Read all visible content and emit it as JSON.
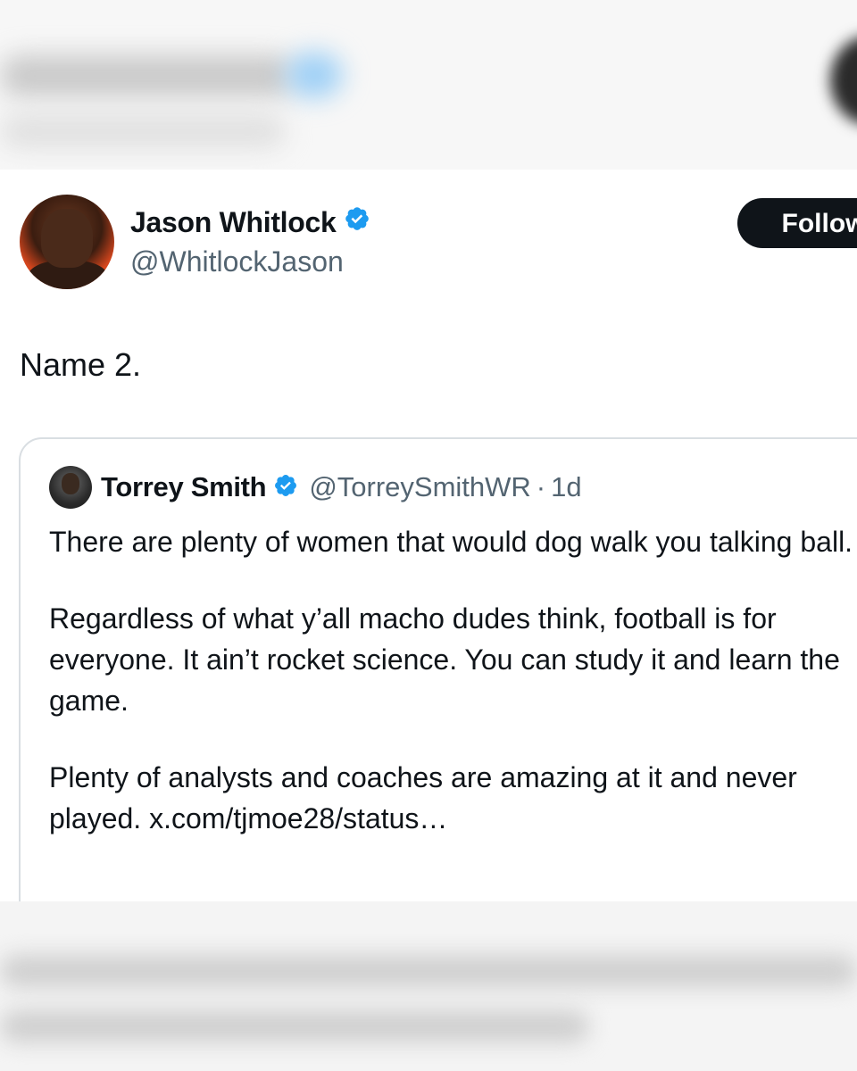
{
  "tweet": {
    "author_name": "Jason Whitlock",
    "author_handle": "@WhitlockJason",
    "follow_label": "Follow",
    "text": "Name 2."
  },
  "quoted": {
    "author_name": "Torrey Smith",
    "author_handle": "@TorreySmithWR",
    "separator": "·",
    "age": "1d",
    "paragraphs": [
      "There are plenty of women that would dog walk you talking ball.",
      "Regardless of what y’all macho dudes think, football is for everyone. It ain’t rocket science. You can study it and learn the game.",
      "Plenty of analysts and coaches are amazing at it and never played. x.com/tjmoe28/status…"
    ]
  },
  "colors": {
    "verified_badge": "#1d9bf0",
    "text_primary": "#0f1419",
    "text_secondary": "#536471",
    "border": "#d9dee2",
    "follow_bg": "#0f1419"
  },
  "icons": {
    "verified": "verified-badge-icon"
  }
}
